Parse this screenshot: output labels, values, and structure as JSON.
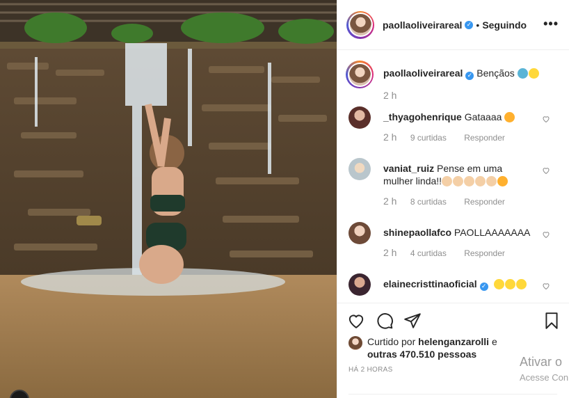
{
  "post": {
    "username": "paollaoliveirareal",
    "separator": "•",
    "follow_status": "Seguindo",
    "more_label": "•••"
  },
  "caption": {
    "username": "paollaoliveirareal",
    "text": "Bençãos",
    "time": "2 h"
  },
  "comments": [
    {
      "username": "_thyagohenrique",
      "text": "Gataaaa",
      "time": "2 h",
      "likes": "9 curtidas",
      "reply": "Responder"
    },
    {
      "username": "vaniat_ruiz",
      "text": "Pense em uma mulher linda!!",
      "time": "2 h",
      "likes": "8 curtidas",
      "reply": "Responder"
    },
    {
      "username": "shinepaollafco",
      "text": "PAOLLAAAAAAA",
      "time": "2 h",
      "likes": "4 curtidas",
      "reply": "Responder"
    },
    {
      "username": "elainecristtinaoficial",
      "text": ""
    }
  ],
  "likes": {
    "prefix": "Curtido por",
    "user": "helenganzarolli",
    "conj": "e",
    "others": "outras 470.510 pessoas",
    "time_ago": "HÁ 2 HORAS"
  },
  "overlay": {
    "activate_title": "Ativar o",
    "activate_sub": "Acesse Con"
  },
  "icons": {
    "verified": "verified-badge-icon",
    "like": "heart-icon",
    "comment": "comment-bubble-icon",
    "share": "paper-plane-icon",
    "save": "bookmark-icon"
  },
  "colors": {
    "verified": "#3897f0",
    "text": "#262626",
    "muted": "#8e8e8e",
    "emoji_yellow": "#ffd83a"
  }
}
